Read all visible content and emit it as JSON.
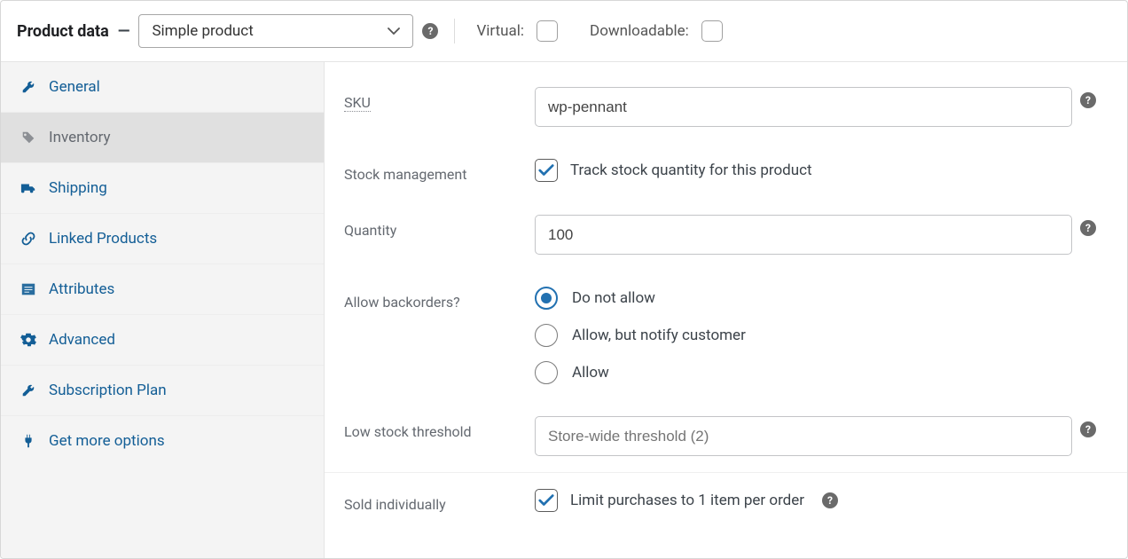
{
  "header": {
    "title": "Product data",
    "product_type": "Simple product",
    "virtual_label": "Virtual:",
    "downloadable_label": "Downloadable:"
  },
  "sidebar": {
    "items": [
      {
        "label": "General"
      },
      {
        "label": "Inventory"
      },
      {
        "label": "Shipping"
      },
      {
        "label": "Linked Products"
      },
      {
        "label": "Attributes"
      },
      {
        "label": "Advanced"
      },
      {
        "label": "Subscription Plan"
      },
      {
        "label": "Get more options"
      }
    ]
  },
  "fields": {
    "sku": {
      "label": "SKU",
      "value": "wp-pennant"
    },
    "stock_mgmt": {
      "label": "Stock management",
      "cb_label": "Track stock quantity for this product"
    },
    "quantity": {
      "label": "Quantity",
      "value": "100"
    },
    "backorders": {
      "label": "Allow backorders?",
      "options": [
        {
          "label": "Do not allow"
        },
        {
          "label": "Allow, but notify customer"
        },
        {
          "label": "Allow"
        }
      ]
    },
    "low_stock": {
      "label": "Low stock threshold",
      "placeholder": "Store-wide threshold (2)"
    },
    "sold_individually": {
      "label": "Sold individually",
      "cb_label": "Limit purchases to 1 item per order"
    }
  }
}
